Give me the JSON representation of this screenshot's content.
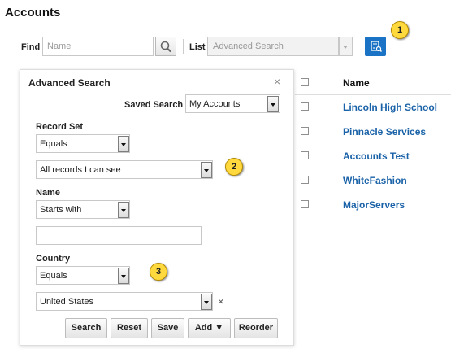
{
  "page": {
    "title": "Accounts"
  },
  "find": {
    "label": "Find",
    "placeholder": "Name"
  },
  "list": {
    "label": "List",
    "value": "Advanced Search"
  },
  "callouts": [
    "1",
    "2",
    "3"
  ],
  "colors": {
    "accent": "#1a73c4",
    "link": "#1a62a8",
    "callout": "#ffd93d"
  },
  "icons": {
    "search": "search-icon",
    "advanced_search": "advanced-search-icon",
    "close": "close-icon",
    "clear": "clear-icon"
  },
  "advanced_search": {
    "title": "Advanced Search",
    "close": "×",
    "saved_search": {
      "label": "Saved Search",
      "value": "My Accounts"
    },
    "record_set": {
      "label": "Record Set",
      "operator": "Equals",
      "value": "All records I can see"
    },
    "name": {
      "label": "Name",
      "operator": "Starts with",
      "value": ""
    },
    "country": {
      "label": "Country",
      "operator": "Equals",
      "value": "United States",
      "clear": "×"
    },
    "buttons": {
      "search": "Search",
      "reset": "Reset",
      "save": "Save",
      "add": "Add ▼",
      "reorder": "Reorder"
    }
  },
  "table": {
    "header": "Name",
    "rows": [
      {
        "name": "Lincoln High School"
      },
      {
        "name": "Pinnacle Services"
      },
      {
        "name": "Accounts Test"
      },
      {
        "name": "WhiteFashion"
      },
      {
        "name": "MajorServers"
      }
    ]
  }
}
